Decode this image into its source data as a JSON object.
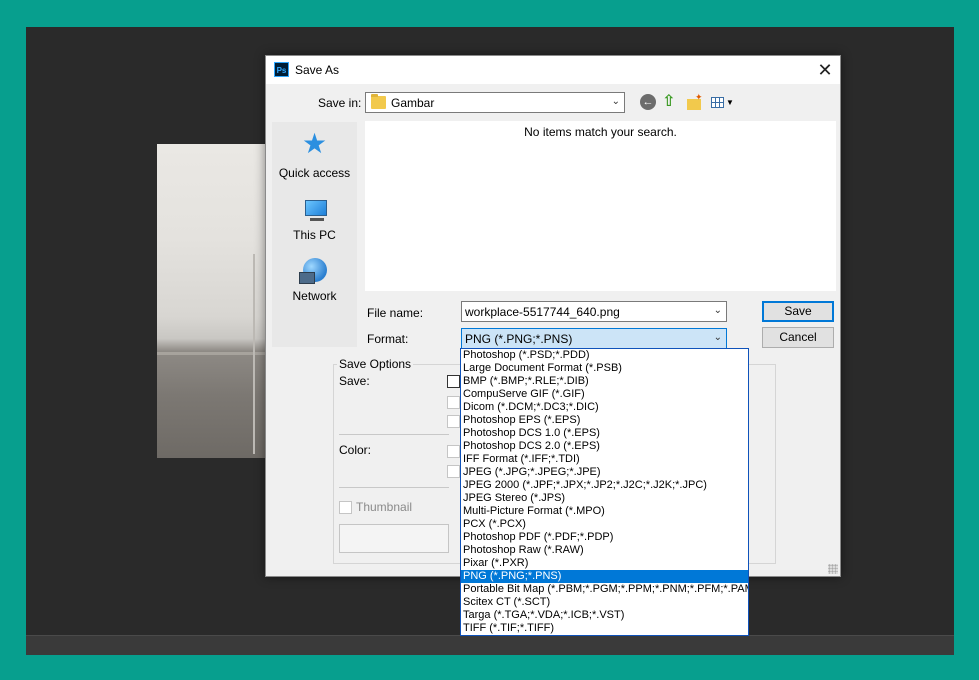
{
  "dialog": {
    "title": "Save As",
    "app_icon_text": "Ps",
    "close_glyph": "✕",
    "save_in_label": "Save in:",
    "save_in_value": "Gambar",
    "empty_message": "No items match your search.",
    "places": [
      {
        "label": "Quick access",
        "icon": "star-icon"
      },
      {
        "label": "This PC",
        "icon": "computer-icon"
      },
      {
        "label": "Network",
        "icon": "network-icon"
      }
    ],
    "file_name_label": "File name:",
    "file_name_value": "workplace-5517744_640.png",
    "format_label": "Format:",
    "format_value": "PNG (*.PNG;*.PNS)",
    "save_button": "Save",
    "cancel_button": "Cancel",
    "save_options_title": "Save Options",
    "save_label": "Save:",
    "color_label": "Color:",
    "thumbnail_label": "Thumbnail"
  },
  "format_options": [
    "Photoshop (*.PSD;*.PDD)",
    "Large Document Format (*.PSB)",
    "BMP (*.BMP;*.RLE;*.DIB)",
    "CompuServe GIF (*.GIF)",
    "Dicom (*.DCM;*.DC3;*.DIC)",
    "Photoshop EPS (*.EPS)",
    "Photoshop DCS 1.0 (*.EPS)",
    "Photoshop DCS 2.0 (*.EPS)",
    "IFF Format (*.IFF;*.TDI)",
    "JPEG (*.JPG;*.JPEG;*.JPE)",
    "JPEG 2000 (*.JPF;*.JPX;*.JP2;*.J2C;*.J2K;*.JPC)",
    "JPEG Stereo (*.JPS)",
    "Multi-Picture Format (*.MPO)",
    "PCX (*.PCX)",
    "Photoshop PDF (*.PDF;*.PDP)",
    "Photoshop Raw (*.RAW)",
    "Pixar (*.PXR)",
    "PNG (*.PNG;*.PNS)",
    "Portable Bit Map (*.PBM;*.PGM;*.PPM;*.PNM;*.PFM;*.PAM)",
    "Scitex CT (*.SCT)",
    "Targa (*.TGA;*.VDA;*.ICB;*.VST)",
    "TIFF (*.TIF;*.TIFF)"
  ],
  "selected_format_index": 17,
  "colors": {
    "accent": "#0078d7",
    "background": "#079f8e",
    "workspace": "#2a2a2a"
  }
}
